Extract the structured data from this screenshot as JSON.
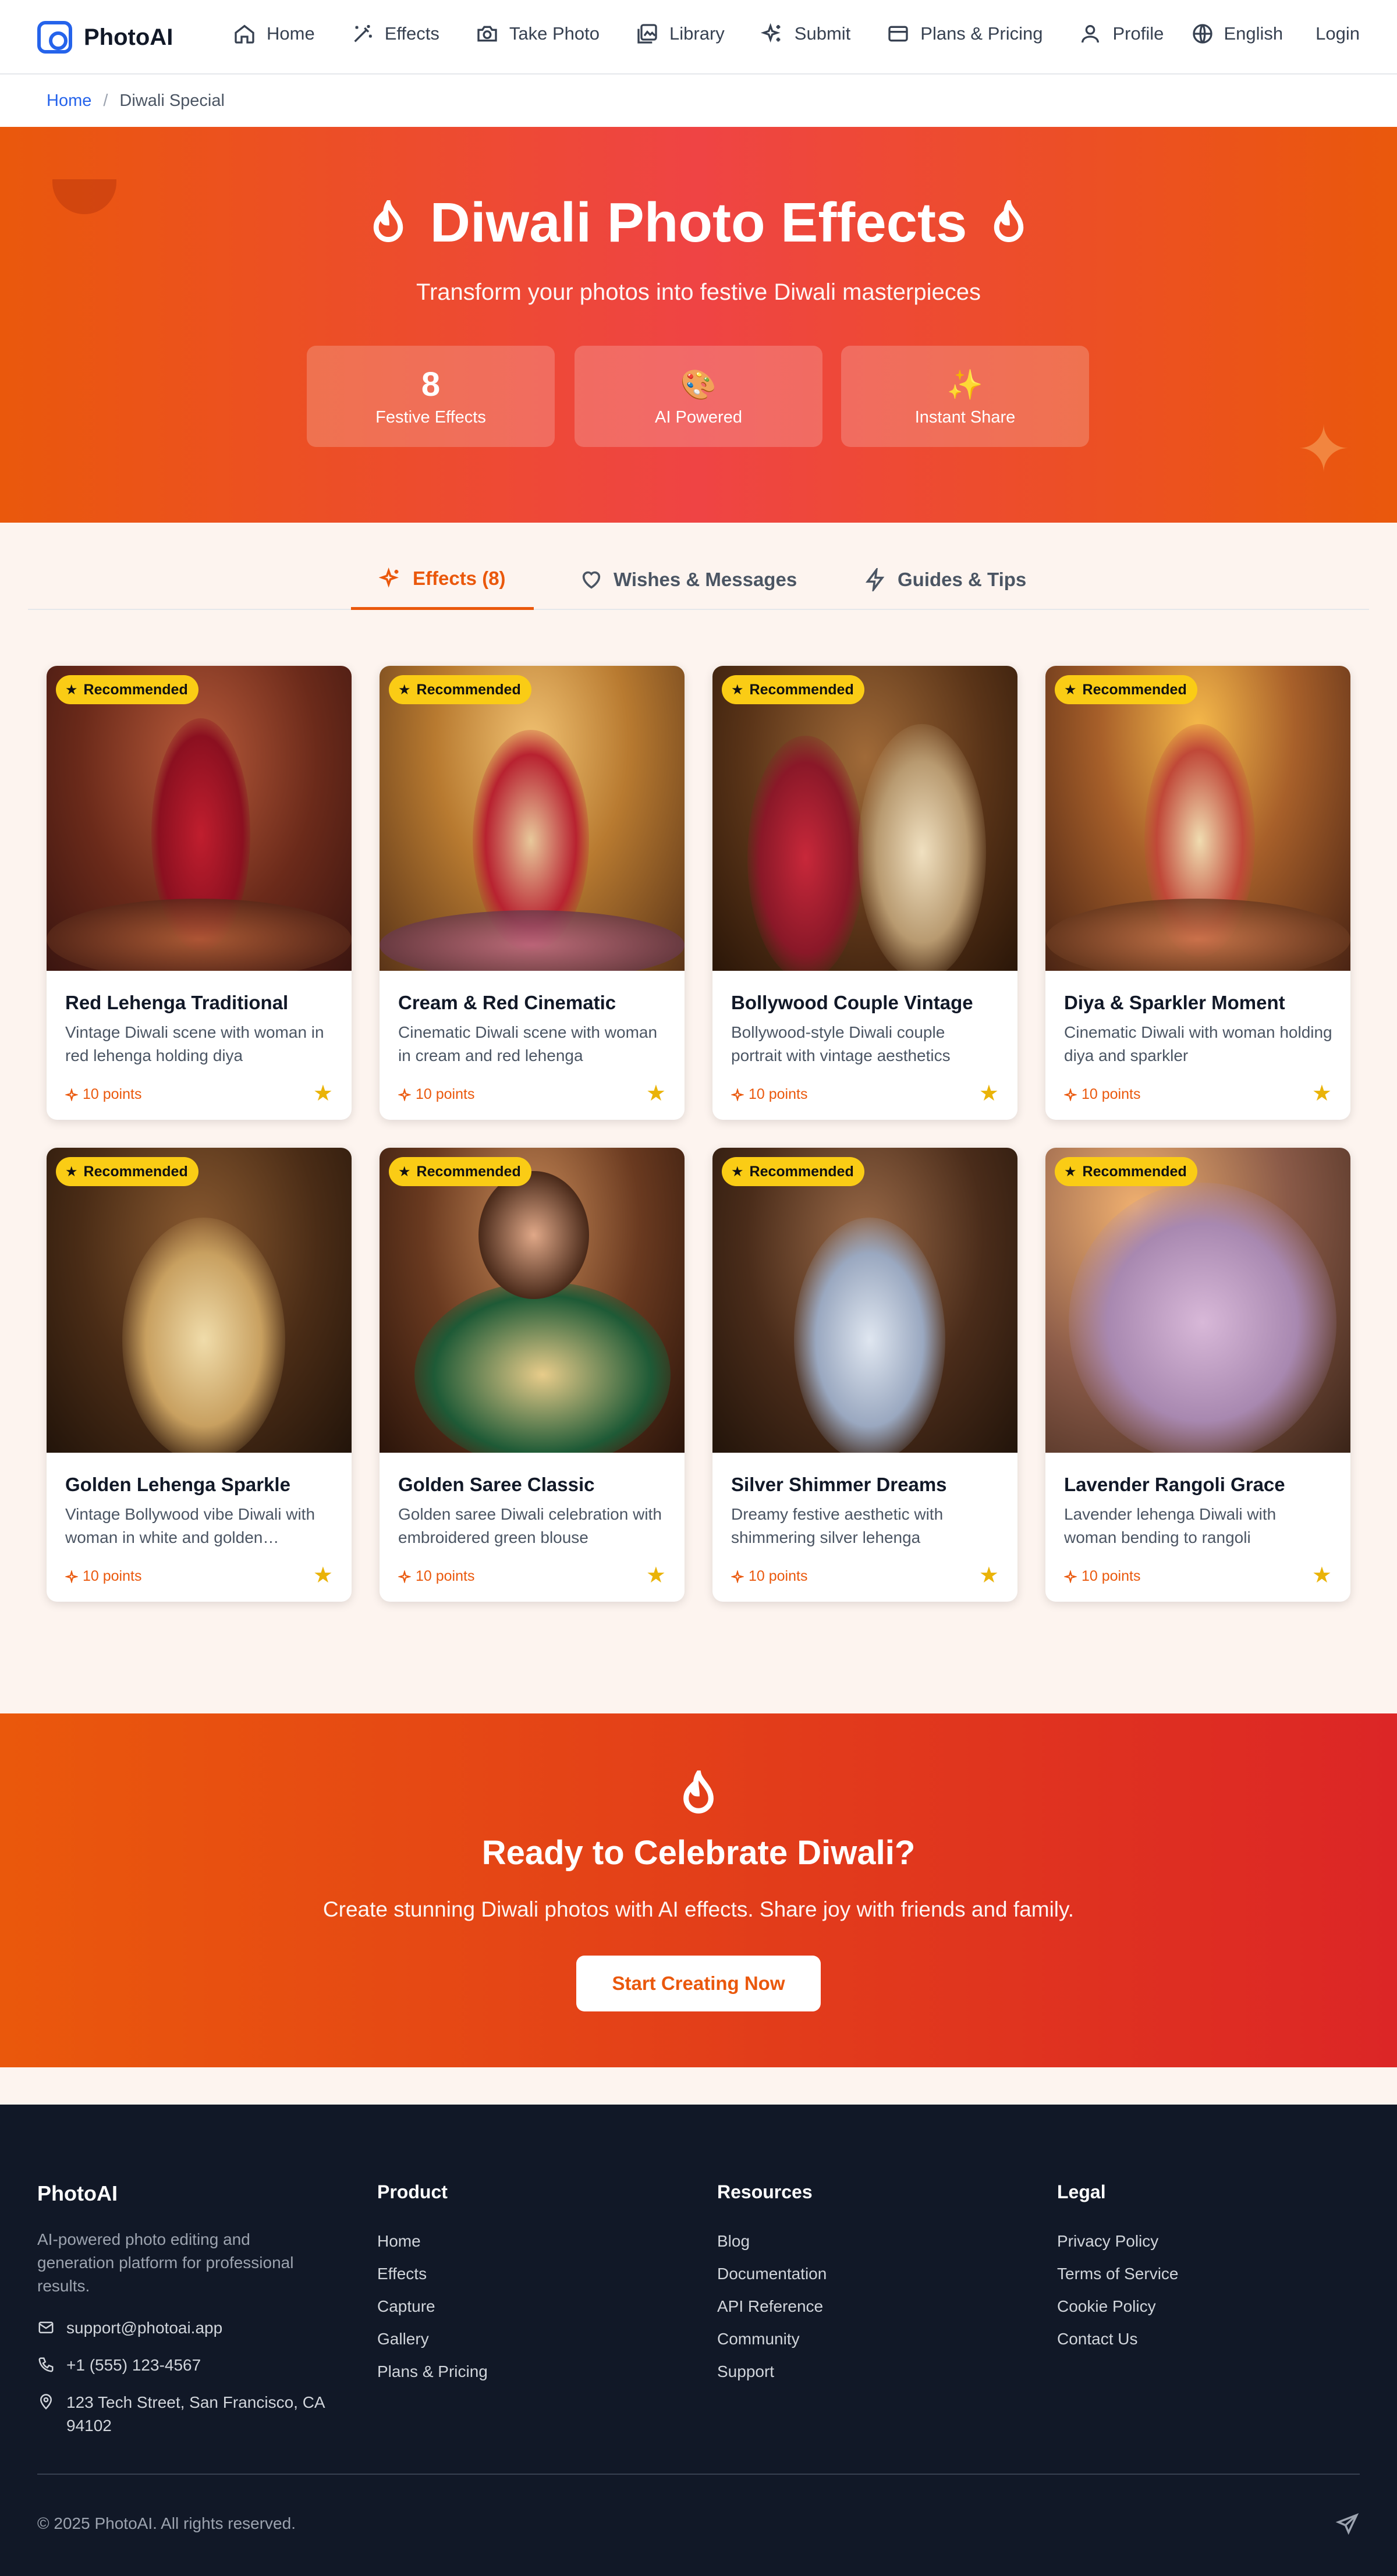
{
  "app": {
    "name": "PhotoAI"
  },
  "nav": {
    "items": [
      {
        "label": "Home",
        "icon": "home-icon"
      },
      {
        "label": "Effects",
        "icon": "magic-wand-icon"
      },
      {
        "label": "Take Photo",
        "icon": "camera-icon"
      },
      {
        "label": "Library",
        "icon": "image-library-icon"
      },
      {
        "label": "Submit",
        "icon": "sparkles-icon"
      },
      {
        "label": "Plans & Pricing",
        "icon": "credit-card-icon"
      },
      {
        "label": "Profile",
        "icon": "user-icon"
      }
    ],
    "language": "English",
    "login": "Login"
  },
  "breadcrumb": {
    "home": "Home",
    "separator": "/",
    "current": "Diwali Special"
  },
  "hero": {
    "title": "Diwali Photo Effects",
    "subtitle": "Transform your photos into festive Diwali masterpieces",
    "stats": [
      {
        "value": "8",
        "label": "Festive Effects"
      },
      {
        "icon": "🎨",
        "label": "AI Powered"
      },
      {
        "icon": "✨",
        "label": "Instant Share"
      }
    ]
  },
  "tabs": [
    {
      "label": "Effects (8)",
      "icon": "sparkles-icon",
      "active": true
    },
    {
      "label": "Wishes & Messages",
      "icon": "heart-icon",
      "active": false
    },
    {
      "label": "Guides & Tips",
      "icon": "lightning-icon",
      "active": false
    }
  ],
  "cards": [
    {
      "badge": "Recommended",
      "title": "Red Lehenga Traditional",
      "description": "Vintage Diwali scene with woman in red lehenga holding diya",
      "points": "10 points"
    },
    {
      "badge": "Recommended",
      "title": "Cream & Red Cinematic",
      "description": "Cinematic Diwali scene with woman in cream and red lehenga",
      "points": "10 points"
    },
    {
      "badge": "Recommended",
      "title": "Bollywood Couple Vintage",
      "description": "Bollywood-style Diwali couple portrait with vintage aesthetics",
      "points": "10 points"
    },
    {
      "badge": "Recommended",
      "title": "Diya & Sparkler Moment",
      "description": "Cinematic Diwali with woman holding diya and sparkler",
      "points": "10 points"
    },
    {
      "badge": "Recommended",
      "title": "Golden Lehenga Sparkle",
      "description": "Vintage Bollywood vibe Diwali with woman in white and golden…",
      "points": "10 points"
    },
    {
      "badge": "Recommended",
      "title": "Golden Saree Classic",
      "description": "Golden saree Diwali celebration with embroidered green blouse",
      "points": "10 points"
    },
    {
      "badge": "Recommended",
      "title": "Silver Shimmer Dreams",
      "description": "Dreamy festive aesthetic with shimmering silver lehenga",
      "points": "10 points"
    },
    {
      "badge": "Recommended",
      "title": "Lavender Rangoli Grace",
      "description": "Lavender lehenga Diwali with woman bending to rangoli",
      "points": "10 points"
    }
  ],
  "cta": {
    "title": "Ready to Celebrate Diwali?",
    "subtitle": "Create stunning Diwali photos with AI effects. Share joy with friends and family.",
    "button": "Start Creating Now"
  },
  "footer": {
    "brand": "PhotoAI",
    "about": "AI-powered photo editing and generation platform for professional results.",
    "email": "support@photoai.app",
    "phone": "+1 (555) 123-4567",
    "address": "123 Tech Street, San Francisco, CA 94102",
    "columns": [
      {
        "title": "Product",
        "links": [
          "Home",
          "Effects",
          "Capture",
          "Gallery",
          "Plans & Pricing"
        ]
      },
      {
        "title": "Resources",
        "links": [
          "Blog",
          "Documentation",
          "API Reference",
          "Community",
          "Support"
        ]
      },
      {
        "title": "Legal",
        "links": [
          "Privacy Policy",
          "Terms of Service",
          "Cookie Policy",
          "Contact Us"
        ]
      }
    ],
    "copyright": "© 2025 PhotoAI. All rights reserved."
  },
  "colors": {
    "accent": "#ea580c",
    "link": "#2563eb",
    "badge": "#facc15",
    "footer_bg": "#111827"
  }
}
